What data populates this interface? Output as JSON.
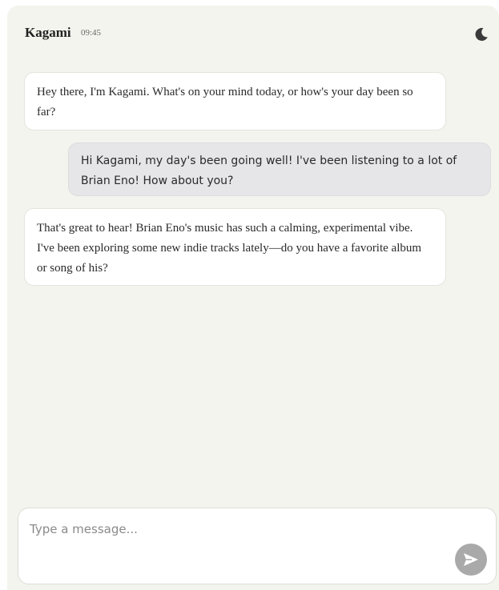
{
  "header": {
    "agent_name": "Kagami",
    "time": "09:45",
    "theme_icon": "moon-icon"
  },
  "messages": [
    {
      "role": "agent",
      "text": "Hey there, I'm Kagami. What's on your mind today, or how's your day been so far?"
    },
    {
      "role": "user",
      "text": "Hi Kagami, my day's been going well! I've been listening to a lot of Brian Eno! How about you?"
    },
    {
      "role": "agent",
      "text": "That's great to hear! Brian Eno's music has such a calming, experimental vibe. I've been exploring some new indie tracks lately—do you have a favorite album or song of his?"
    }
  ],
  "composer": {
    "placeholder": "Type a message...",
    "value": "",
    "send_icon": "send-icon"
  },
  "colors": {
    "background": "#f4f4ee",
    "agent_bubble": "#ffffff",
    "user_bubble": "#e6e6e9",
    "send_button": "#a9a9a9"
  }
}
